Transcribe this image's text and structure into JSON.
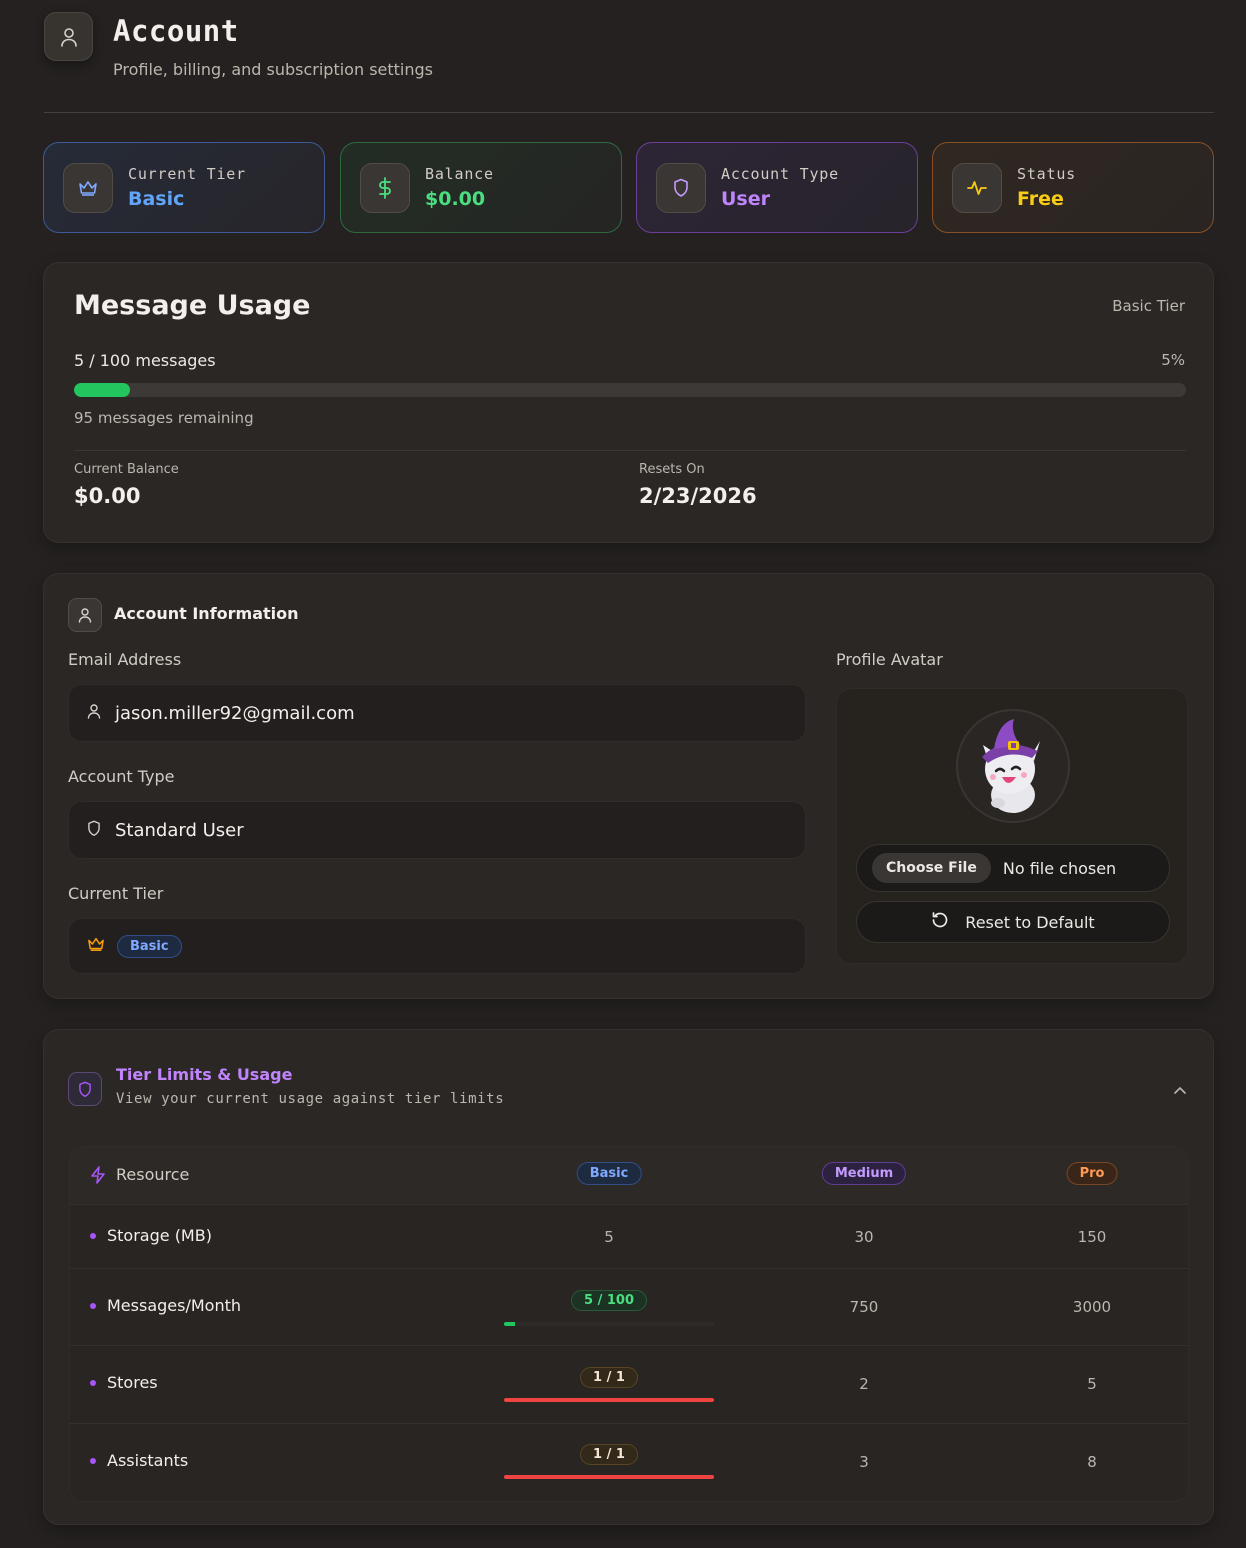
{
  "header": {
    "title": "Account",
    "subtitle": "Profile, billing, and subscription settings"
  },
  "stats": [
    {
      "label": "Current Tier",
      "value": "Basic",
      "color": "#60a5fa",
      "icon": "crown-icon"
    },
    {
      "label": "Balance",
      "value": "$0.00",
      "color": "#4ade80",
      "icon": "dollar-icon"
    },
    {
      "label": "Account Type",
      "value": "User",
      "color": "#c084fc",
      "icon": "shield-icon"
    },
    {
      "label": "Status",
      "value": "Free",
      "color": "#facc15",
      "icon": "activity-icon"
    }
  ],
  "usage": {
    "title": "Message Usage",
    "tier": "Basic Tier",
    "count": "5 / 100 messages",
    "percent_text": "5%",
    "percent": 5,
    "remaining": "95 messages remaining",
    "balance_label": "Current Balance",
    "balance_value": "$0.00",
    "resets_label": "Resets On",
    "resets_value": "2/23/2026"
  },
  "account_info": {
    "title": "Account Information",
    "email_label": "Email Address",
    "email": "jason.miller92@gmail.com",
    "type_label": "Account Type",
    "type": "Standard User",
    "tier_label": "Current Tier",
    "tier": "Basic",
    "avatar_label": "Profile Avatar",
    "choose_file": "Choose File",
    "no_file": "No file chosen",
    "reset": "Reset to Default"
  },
  "tier_limits": {
    "title": "Tier Limits & Usage",
    "subtitle": "View your current usage against tier limits",
    "columns": {
      "resource": "Resource",
      "basic": "Basic",
      "medium": "Medium",
      "pro": "Pro"
    },
    "rows": [
      {
        "name": "Storage (MB)",
        "basic": "5",
        "medium": "30",
        "pro": "150"
      },
      {
        "name": "Messages/Month",
        "basic": "5 / 100",
        "basic_fraction": 0.05,
        "medium": "750",
        "pro": "3000"
      },
      {
        "name": "Stores",
        "basic": "1 / 1",
        "basic_fraction": 1.0,
        "medium": "2",
        "pro": "5"
      },
      {
        "name": "Assistants",
        "basic": "1 / 1",
        "basic_fraction": 1.0,
        "medium": "3",
        "pro": "8"
      }
    ]
  },
  "colors": {
    "accent_green": "#22c55e",
    "accent_red": "#ef4444",
    "accent_purple": "#a855f7",
    "background": "#242120"
  }
}
